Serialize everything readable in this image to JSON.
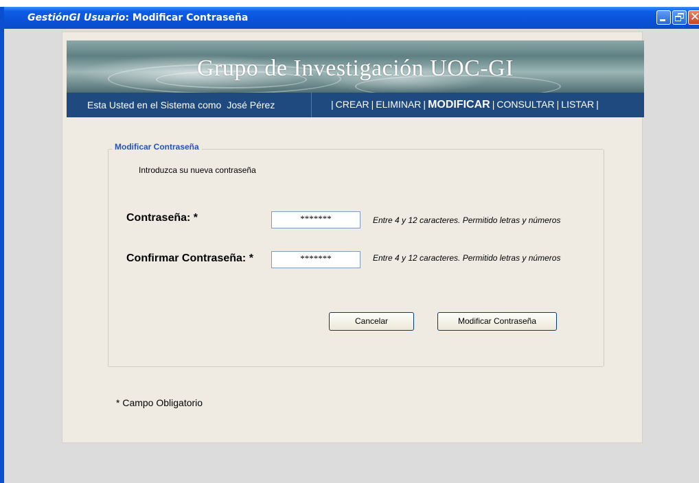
{
  "window": {
    "app_name": "GestiónGI Usuario",
    "separator": ":",
    "title": "Modificar Contraseña"
  },
  "banner": {
    "title": "Grupo de Investigación UOC-GI"
  },
  "navbar": {
    "user_prefix": "Esta Usted en el Sistema como",
    "user_name": "José Pérez",
    "menu": [
      "CREAR",
      "ELIMINAR",
      "MODIFICAR",
      "CONSULTAR",
      "LISTAR"
    ],
    "active": "MODIFICAR"
  },
  "form": {
    "legend": "Modificar Contraseña",
    "intro": "Introduzca su nueva contraseña",
    "password": {
      "label": "Contraseña: *",
      "value": "*******",
      "hint": "Entre 4 y 12 caracteres. Permitido letras y números"
    },
    "confirm": {
      "label": "Confirmar Contraseña: *",
      "value": "*******",
      "hint": "Entre 4 y 12 caracteres. Permitido letras y números"
    },
    "cancel_label": "Cancelar",
    "submit_label": "Modificar Contraseña"
  },
  "footer": {
    "mandatory_note": "* Campo Obligatorio"
  },
  "colors": {
    "titlebar": "#0a52d9",
    "navbar": "#1f4a80",
    "legend": "#2552b5",
    "page_background": "#efebe2"
  }
}
